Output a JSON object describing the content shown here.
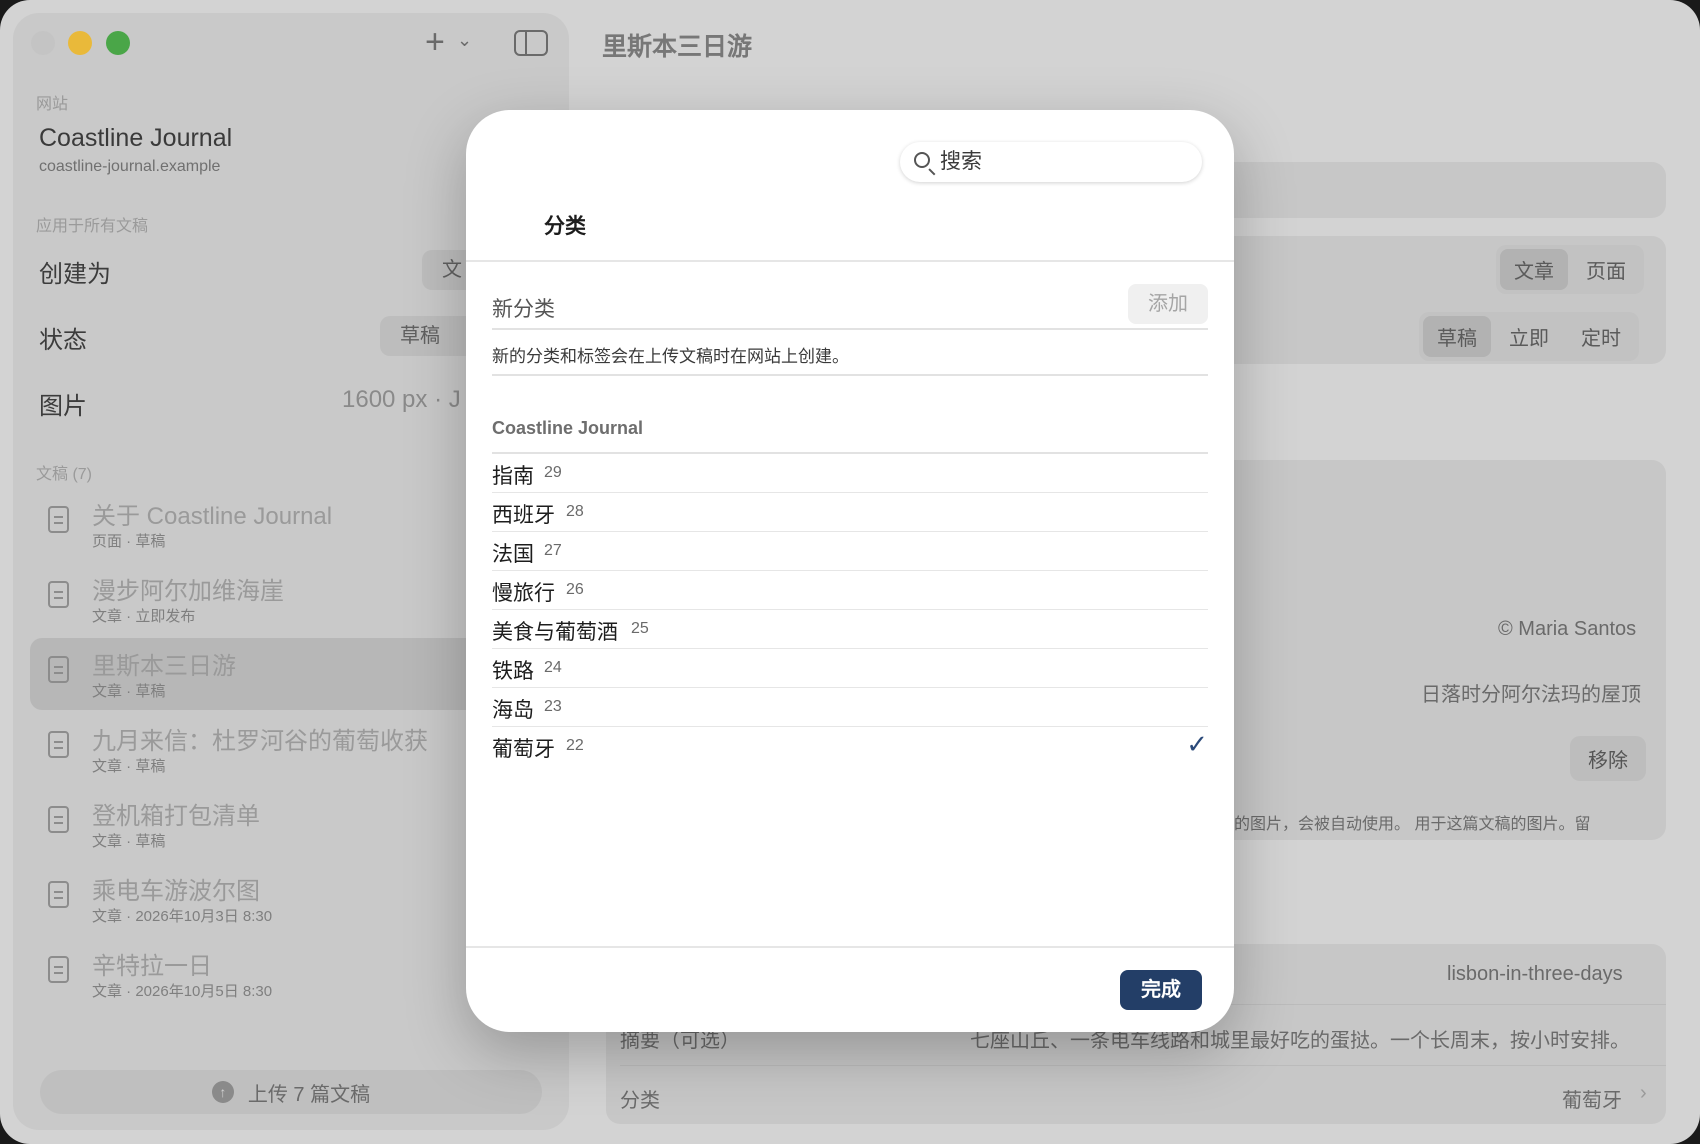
{
  "window": {
    "title": "里斯本三日游"
  },
  "sidebar": {
    "site_section": "网站",
    "site_name": "Coastline Journal",
    "site_url": "coastline-journal.example",
    "apply_section": "应用于所有文稿",
    "create_as_label": "创建为",
    "create_as_value": "文",
    "status_label": "状态",
    "status_value": "草稿",
    "images_label": "图片",
    "images_value": "1600 px · J",
    "docs_section": "文稿 (7)",
    "docs": [
      {
        "title": "关于 Coastline Journal",
        "sub": "页面 · 草稿"
      },
      {
        "title": "漫步阿尔加维海崖",
        "sub": "文章 · 立即发布"
      },
      {
        "title": "里斯本三日游",
        "sub": "文章 · 草稿"
      },
      {
        "title": "九月来信：杜罗河谷的葡萄收获",
        "sub": "文章 · 草稿"
      },
      {
        "title": "登机箱打包清单",
        "sub": "文章 · 草稿"
      },
      {
        "title": "乘电车游波尔图",
        "sub": "文章 · 2026年10月3日 8:30"
      },
      {
        "title": "辛特拉一日",
        "sub": "文章 · 2026年10月5日 8:30"
      }
    ],
    "upload_button": "上传 7 篇文稿"
  },
  "main": {
    "type_seg": [
      "文章",
      "页面"
    ],
    "publish_seg": [
      "草稿",
      "立即",
      "定时"
    ],
    "credit": "© Maria Santos",
    "caption": "日落时分阿尔法玛的屋顶",
    "remove_button": "移除",
    "image_note": "的图片，会被自动使用。 用于这篇文稿的图片。留",
    "slug": "lisbon-in-three-days",
    "excerpt_label": "摘要（可选）",
    "excerpt_value": "七座山丘、一条电车线路和城里最好吃的蛋挞。一个长周末，按小时安排。",
    "category_label": "分类",
    "category_value": "葡萄牙"
  },
  "sheet": {
    "search_placeholder": "搜索",
    "title": "分类",
    "new_category_placeholder": "新分类",
    "add_button": "添加",
    "note": "新的分类和标签会在上传文稿时在网站上创建。",
    "group": "Coastline Journal",
    "categories": [
      {
        "name": "指南",
        "count": "29",
        "checked": false
      },
      {
        "name": "西班牙",
        "count": "28",
        "checked": false
      },
      {
        "name": "法国",
        "count": "27",
        "checked": false
      },
      {
        "name": "慢旅行",
        "count": "26",
        "checked": false
      },
      {
        "name": "美食与葡萄酒",
        "count": "25",
        "checked": false
      },
      {
        "name": "铁路",
        "count": "24",
        "checked": false
      },
      {
        "name": "海岛",
        "count": "23",
        "checked": false
      },
      {
        "name": "葡萄牙",
        "count": "22",
        "checked": true
      }
    ],
    "done_button": "完成"
  },
  "icons": {
    "check": "checkmark-icon",
    "search": "search-icon",
    "doc": "document-icon",
    "upload": "upload-arrow-icon"
  },
  "colors": {
    "accent": "#233e67",
    "check": "#2b4a7a"
  }
}
